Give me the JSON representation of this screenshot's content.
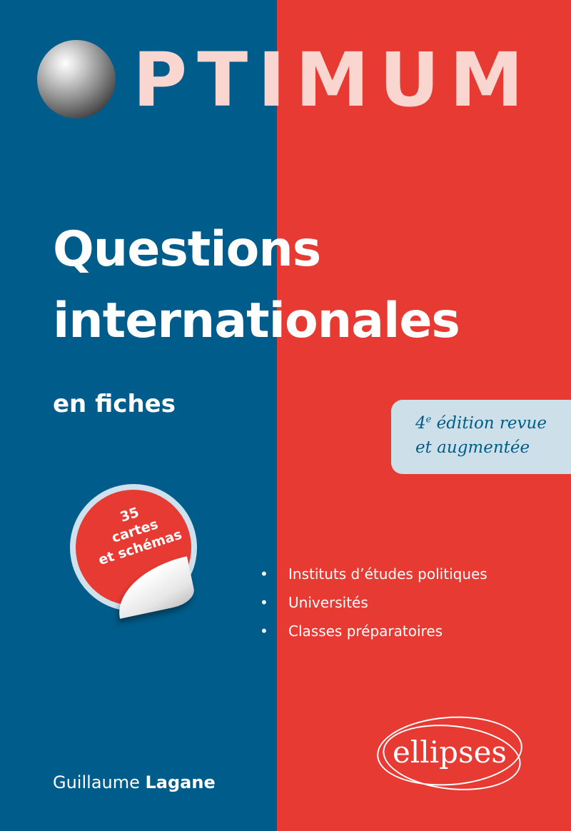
{
  "series": {
    "name": "PTIMUM",
    "sphere": "sphere-O-logo"
  },
  "title": {
    "line1": "Questions",
    "line2": "internationales"
  },
  "subtitle": "en fiches",
  "edition": {
    "number": "4",
    "suffix": "e",
    "line1_rest": " édition revue",
    "line2": "et augmentée"
  },
  "sticker": {
    "line1": "35",
    "line2": "cartes",
    "line3": "et schémas"
  },
  "audience": [
    "Instituts d’études politiques",
    "Universités",
    "Classes préparatoires"
  ],
  "author": {
    "first": "Guillaume",
    "last": "Lagane"
  },
  "publisher": "ellipses",
  "colors": {
    "left_panel": "#005c8a",
    "right_panel": "#e63a33",
    "series_text": "#f9d6cf",
    "edition_box": "#cde0ea"
  }
}
